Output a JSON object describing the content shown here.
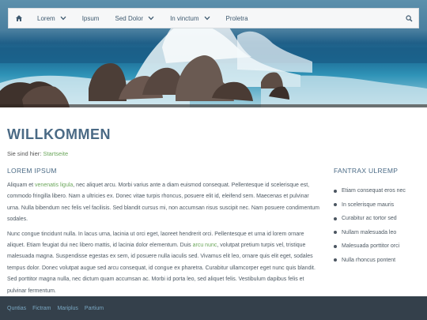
{
  "nav": {
    "items": [
      {
        "label": "Lorem",
        "dropdown": true
      },
      {
        "label": "Ipsum",
        "dropdown": false
      },
      {
        "label": "Sed Dolor",
        "dropdown": true
      },
      {
        "label": "In vinctum",
        "dropdown": true
      },
      {
        "label": "Proletra",
        "dropdown": false
      }
    ],
    "icons": {
      "home": "home-icon",
      "search": "search-icon",
      "dropdown": "chevron-down-icon"
    }
  },
  "page": {
    "title": "WILLKOMMEN",
    "breadcrumb_prefix": "Sie sind hier:",
    "breadcrumb_link": "Startseite"
  },
  "main": {
    "heading": "LOREM IPSUM",
    "p1": {
      "t1": "Aliquam et ",
      "link": "venenatis ligula",
      "t2": ", nec aliquet arcu. Morbi varius ante a diam euismod consequat. Pellentesque id scelerisque est, commodo fringilla libero. Nam a ultricies ex. Donec vitae turpis rhoncus, posuere elit id, eleifend sem. Maecenas et pulvinar urna. Nulla bibendum nec felis vel facilisis. Sed blandit cursus mi, non accumsan risus suscipit nec. Nam posuere condimentum sodales."
    },
    "p2": {
      "t1": "Nunc congue tincidunt nulla. In lacus urna, lacinia ut orci eget, laoreet hendrerit orci. Pellentesque et urna id lorem ornare aliquet. Etiam feugiat dui nec libero mattis, id lacinia dolor elementum. Duis ",
      "link": "arcu nunc",
      "t2": ", volutpat pretium turpis vel, tristique malesuada magna. Suspendisse egestas ex sem, id posuere nulla iaculis sed. Vivamus elit leo, ornare quis elit eget, sodales tempus dolor. Donec volutpat augue sed arcu consequat, id congue ex pharetra. Curabitur ullamcorper eget nunc quis blandit. Sed porttitor magna nulla, nec dictum quam accumsan ac. Morbi id porta leo, sed aliquet felis. Vestibulum dapibus felis et pulvinar fermentum."
    }
  },
  "sidebar": {
    "heading": "FANTRAX ULREMP",
    "items": [
      "Etiam consequat eros nec",
      "In scelerisque mauris",
      "Curabitur ac tortor sed",
      "Nullam malesuada leo",
      "Malesuada porttitor orci",
      "Nulla rhoncus pontent"
    ]
  },
  "footer": {
    "links": [
      "Quntias",
      "Fictram",
      "Mariplus",
      "Partium"
    ]
  },
  "colors": {
    "accent": "#6aa65a",
    "heading": "#4a6a85",
    "footer_bg": "#34404b",
    "footer_link": "#7aa7c2"
  }
}
